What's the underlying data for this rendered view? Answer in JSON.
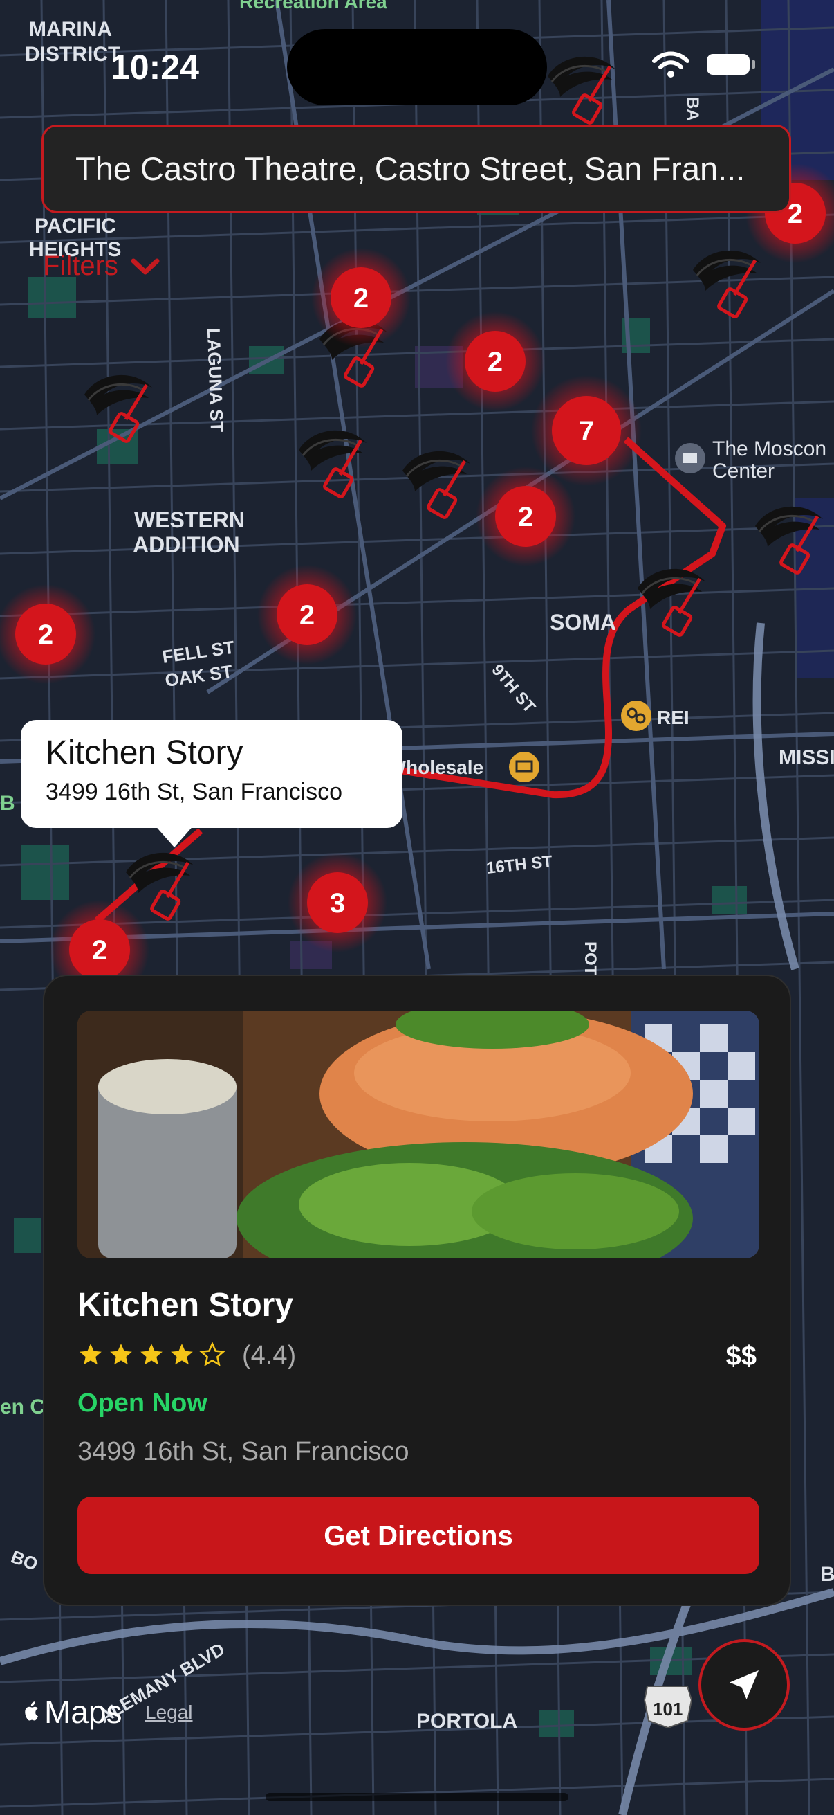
{
  "status_bar": {
    "time": "10:24"
  },
  "search": {
    "value": "The Castro Theatre, Castro Street, San Fran..."
  },
  "filters": {
    "label": "Filters"
  },
  "map": {
    "labels": {
      "marina": "MARINA",
      "district": "DISTRICT",
      "recreation_area": "Recreation Area",
      "pacific": "PACIFIC",
      "heights": "HEIGHTS",
      "laguna": "LAGUNA ST",
      "western": "WESTERN",
      "addition": "ADDITION",
      "fell": "FELL ST",
      "oak": "OAK ST",
      "soma": "SOMA",
      "ninth": "9TH ST",
      "sixteenth": "16TH ST",
      "costco": "Costco Wholesale",
      "rei": "REI",
      "moscone_1": "The Moscon",
      "moscone_2": "Center",
      "mission": "MISSI",
      "portola": "PORTOLA",
      "alemany": "ALEMANY BLVD",
      "highway": "101",
      "potrero": "POT",
      "left_1": "B",
      "left_2": "en C",
      "left_3": "BO",
      "right_edge": "B",
      "top_right": "BA"
    },
    "clusters": [
      "2",
      "2",
      "2",
      "7",
      "2",
      "2",
      "2",
      "2",
      "3",
      "2"
    ]
  },
  "callout": {
    "title": "Kitchen Story",
    "address": "3499 16th St, San Francisco"
  },
  "card": {
    "title": "Kitchen Story",
    "rating": 4.4,
    "rating_text": "(4.4)",
    "price": "$$",
    "status": "Open Now",
    "address": "3499 16th St, San Francisco",
    "button": "Get Directions"
  },
  "footer": {
    "maps_label": "Maps",
    "legal": "Legal"
  },
  "colors": {
    "accent": "#c41a1f",
    "open": "#27d466",
    "card": "#1b1b1b",
    "map_bg": "#1c2331"
  }
}
